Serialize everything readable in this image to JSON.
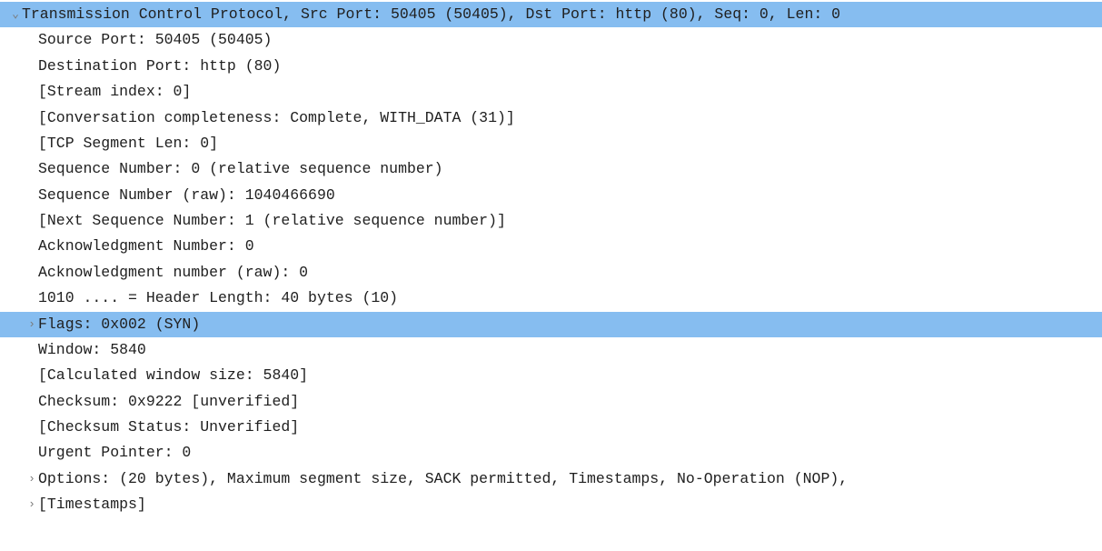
{
  "tcp": {
    "header": "Transmission Control Protocol, Src Port: 50405 (50405), Dst Port: http (80), Seq: 0, Len: 0",
    "src_port": "Source Port: 50405 (50405)",
    "dst_port": "Destination Port: http (80)",
    "stream_index": "[Stream index: 0]",
    "conversation_completeness": "[Conversation completeness: Complete, WITH_DATA (31)]",
    "tcp_segment_len": "[TCP Segment Len: 0]",
    "seq_num": "Sequence Number: 0    (relative sequence number)",
    "seq_num_raw": "Sequence Number (raw): 1040466690",
    "next_seq_num": "[Next Sequence Number: 1    (relative sequence number)]",
    "ack_num": "Acknowledgment Number: 0",
    "ack_num_raw": "Acknowledgment number (raw): 0",
    "header_length": "1010 .... = Header Length: 40 bytes (10)",
    "flags": "Flags: 0x002 (SYN)",
    "window": "Window: 5840",
    "calc_window": "[Calculated window size: 5840]",
    "checksum": "Checksum: 0x9222 [unverified]",
    "checksum_status": "[Checksum Status: Unverified]",
    "urgent_pointer": "Urgent Pointer: 0",
    "options": "Options: (20 bytes), Maximum segment size, SACK permitted, Timestamps, No-Operation (NOP),",
    "timestamps": "[Timestamps]"
  },
  "markers": {
    "expanded": "⌄",
    "collapsed": "›"
  }
}
